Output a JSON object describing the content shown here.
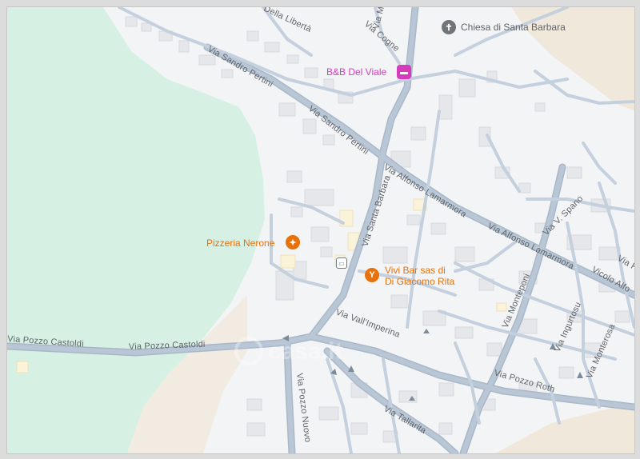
{
  "map": {
    "colors": {
      "park": "#d6f1e3",
      "sand": "#f1e8dc",
      "road": "#b8c6d6",
      "road_edge": "#a9b8c8",
      "building": "#e6e7ea",
      "building_edge": "#d7d9dd",
      "food": "#e8710a",
      "lodging": "#d63bbd",
      "worship": "#70757a",
      "transit": "#6a7b8c"
    },
    "streets": [
      "Via Sandro Pertini",
      "Via Sandro Pertini",
      "Via Alfonso Lamarmora",
      "Via Alfonso Lamarmora",
      "Via Santa Barbara",
      "Via Pozzo Castoldi",
      "Via Pozzo Castoldi",
      "Via Vall'Imperina",
      "Via Monteponi",
      "Via Pozzo Nuovo",
      "Via Pozzo Roth",
      "Via Tallarita",
      "Via Ingurtosu",
      "Via Monterosa",
      "Via V. Spano",
      "Vicolo Alfo",
      "Via F",
      "Via Cogne",
      "Della Libertà",
      "Via Micca"
    ],
    "pois": [
      {
        "name": "Chiesa di Santa Barbara",
        "icon": "church-icon",
        "glyph": "✝",
        "category": "worship"
      },
      {
        "name": "B&B Del Viale",
        "icon": "hotel-icon",
        "glyph": "🛏",
        "category": "lodging"
      },
      {
        "name": "Pizzeria Nerone",
        "icon": "restaurant-icon",
        "glyph": "🍴",
        "category": "food"
      },
      {
        "name": "Vivi Bar sas di",
        "name2": "Di Giacomo Rita",
        "icon": "bar-icon",
        "glyph": "🍸",
        "category": "food"
      }
    ],
    "transit_icon": "bus-stop-icon",
    "watermark": "casa.it"
  }
}
